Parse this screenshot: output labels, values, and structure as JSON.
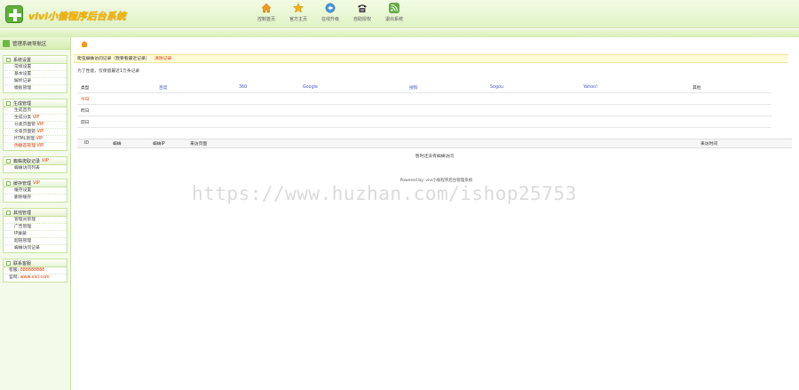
{
  "app": {
    "title": "vivi小偷程序后台系统"
  },
  "header": {
    "nav": [
      {
        "label": "控制首页",
        "icon": "home-icon"
      },
      {
        "label": "官方主页",
        "icon": "star-icon"
      },
      {
        "label": "在线升级",
        "icon": "update-icon"
      },
      {
        "label": "自助授权",
        "icon": "phone-icon"
      },
      {
        "label": "退出系统",
        "icon": "rss-exit-icon"
      }
    ]
  },
  "sidebar": {
    "title": "管理系统导航区",
    "groups": [
      {
        "label": "系统设置",
        "vip": "",
        "items": [
          {
            "label": "常规设置"
          },
          {
            "label": "基本设置"
          },
          {
            "label": "解析记录"
          },
          {
            "label": "模板管理"
          }
        ]
      },
      {
        "label": "生成管理",
        "vip": "",
        "items": [
          {
            "label": "生成首页",
            "vip": ""
          },
          {
            "label": "生成分类",
            "vip": "VIP"
          },
          {
            "label": "分类页面管",
            "vip": "VIP"
          },
          {
            "label": "文章页面管",
            "vip": "VIP"
          },
          {
            "label": "HTML管理",
            "vip": "VIP"
          },
          {
            "label": "伪静态管理",
            "vip": "VIP",
            "red": true
          }
        ]
      },
      {
        "label": "蜘蛛爬取记录",
        "vip": "VIP",
        "items": [
          {
            "label": "蜘蛛访问列表"
          }
        ]
      },
      {
        "label": "缓存管理",
        "vip": "VIP",
        "items": [
          {
            "label": "缓存设置"
          },
          {
            "label": "删除缓存"
          }
        ]
      },
      {
        "label": "其他管理",
        "vip": "",
        "items": [
          {
            "label": "管理员管理"
          },
          {
            "label": "广告管理"
          },
          {
            "label": "IP屏蔽"
          },
          {
            "label": "超链管理"
          },
          {
            "label": "蜘蛛访问记录"
          }
        ]
      },
      {
        "label": "联系客服",
        "vip": "",
        "items": [
          {
            "label": "客服:",
            "value": "888888888"
          },
          {
            "label": "官网:",
            "value": "www.vivi.com"
          }
        ]
      }
    ]
  },
  "main": {
    "notice": "爬虫蜘蛛访问记录（我要看最近记录）",
    "notice_link": "清除记录",
    "description": "为了性能，仅保留最近1万条记录",
    "stats": {
      "headers": [
        "类型",
        "百度",
        "360",
        "Google",
        "搜狗",
        "Sogou",
        "Yahoo!",
        "其他"
      ],
      "rows": [
        "今日",
        "昨日",
        "前日"
      ]
    },
    "log": {
      "headers": [
        "ID",
        "蜘蛛",
        "蜘蛛IP",
        "来访页面",
        "来访时间"
      ],
      "empty": "暂时还没有蜘蛛访问"
    },
    "powered": "Powered by: vivi小偷程序后台管理系统"
  },
  "watermark": "https://www.huzhan.com/ishop25753"
}
